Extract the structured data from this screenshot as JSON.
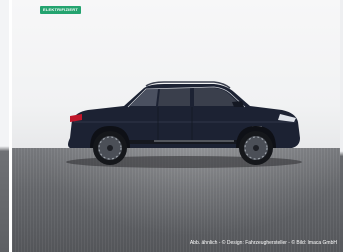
{
  "gallery": {
    "badge_label": "ELEKTRIFIZIERT",
    "image_caption": "Abb. ähnlich - © Design: Fahrzeughersteller - © Bild: Imaca GmbH",
    "colors": {
      "badge": "#23a36f",
      "car_paint": "#1c2233",
      "floor": "#67696d",
      "wall": "#f1f2f3"
    }
  }
}
